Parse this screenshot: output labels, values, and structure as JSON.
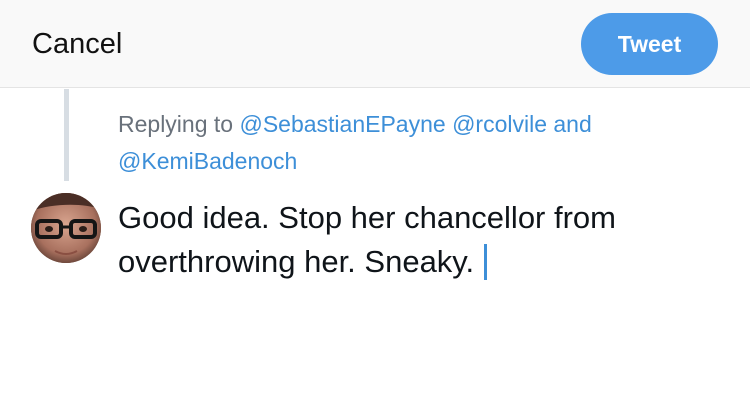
{
  "header": {
    "cancel_label": "Cancel",
    "tweet_label": "Tweet"
  },
  "reply": {
    "prefix": "Replying to",
    "mention_1": "@SebastianEPayne",
    "mention_2": "@rcolvile",
    "conjunction": "and",
    "mention_3": "@KemiBadenoch"
  },
  "composer": {
    "text": "Good idea. Stop her chancellor from overthrowing her. Sneaky."
  },
  "colors": {
    "accent": "#4d9be8",
    "mention": "#3d8fd8",
    "muted_text": "#69717b",
    "header_bg": "#f9f9f9"
  }
}
